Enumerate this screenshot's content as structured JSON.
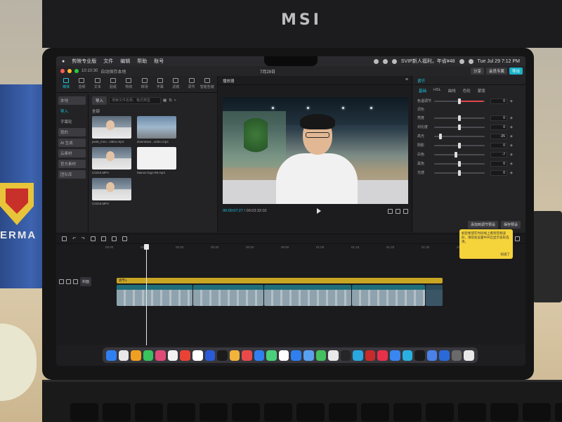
{
  "monitor": {
    "brand": "MSI"
  },
  "mug": {
    "text": "ERMA"
  },
  "keyboard": {
    "keys": [
      "",
      "",
      "",
      "",
      "",
      "",
      "",
      "",
      "",
      "",
      "",
      "",
      "",
      "",
      "",
      ""
    ]
  },
  "menubar": {
    "items": [
      "剪映专业版",
      "文件",
      "编辑",
      "帮助",
      "账号"
    ],
    "right_status": "SVIP新人福利，年省¥48",
    "clock": "Tue Jul 29  7:12 PM"
  },
  "titlebar": {
    "timer": "10:10:30",
    "autosave": "自动保存本地",
    "project_title": "7月29日",
    "buttons": [
      "分享",
      "会员专属",
      "导出"
    ]
  },
  "media": {
    "tools": [
      "媒体",
      "音频",
      "文本",
      "贴纸",
      "特效",
      "转场",
      "字幕",
      "滤镜",
      "调节",
      "智能包装"
    ],
    "categories": [
      "本地",
      "导入",
      "字幕轮",
      "我的",
      "AI 生成",
      "云素材",
      "官方素材",
      "团队库"
    ],
    "import_label": "导入",
    "search_placeholder": "搜索文件名称、格式类型",
    "all_label": "全部",
    "clips": [
      {
        "name": "peak_inno...video.mp4",
        "kind": "person"
      },
      {
        "name": "downtown...video.mp4",
        "kind": "city"
      },
      {
        "name": "C0316.MP4",
        "kind": "person"
      },
      {
        "name": "Manus-logo-99.mp4",
        "kind": "white"
      },
      {
        "name": "C0315.MP4",
        "kind": "person"
      }
    ]
  },
  "player": {
    "title": "播放器",
    "current_time": "00:00:07:27",
    "total_time": "00:03:32:02"
  },
  "adjust": {
    "title": "调节",
    "tabs": [
      "基础",
      "HSL",
      "曲线",
      "色轮",
      "蒙版"
    ],
    "top_row": {
      "label": "色温调节",
      "value": "0"
    },
    "section": "调色",
    "rows": [
      {
        "label": "亮度",
        "value": "0",
        "pos": 0.5
      },
      {
        "label": "对比度",
        "value": "0",
        "pos": 0.5
      },
      {
        "label": "高光",
        "value": "-35",
        "pos": 0.1
      },
      {
        "label": "阴影",
        "value": "0",
        "pos": 0.5
      },
      {
        "label": "白色",
        "value": "-7",
        "pos": 0.42
      },
      {
        "label": "黑色",
        "value": "0",
        "pos": 0.5
      },
      {
        "label": "光感",
        "value": "0",
        "pos": 0.5
      }
    ],
    "footer_buttons": [
      "添加到调节预设",
      "保存预设"
    ]
  },
  "tooltip": {
    "text": "如您希望在时间线上看到音频波形，请前往设置中开启显示波形选项。",
    "button": "知道了"
  },
  "timeline": {
    "ruler_marks": [
      "00:00",
      "00:10",
      "00:20",
      "00:30",
      "00:40",
      "00:50",
      "01:00",
      "01:10",
      "01:20",
      "01:30",
      "01:40",
      "01:50"
    ],
    "cover_label": "封面",
    "yellow_label": "调节1",
    "clips": [
      {
        "label": "C0316.MP4  00:00:29:07"
      },
      {
        "label": "C0315.MP4  00:00:20:03"
      },
      {
        "label": "C0316.MP4  00:00:29:15  清晰度 语速人声"
      },
      {
        "label": "C0316.MP4  00:00:21:03  清晰度 语速人声"
      },
      {
        "label": "Manus"
      }
    ]
  },
  "dock": {
    "colors": [
      "#2f7ff0",
      "#e8e8e8",
      "#f0a020",
      "#3ac25e",
      "#e04a78",
      "#f2f2f2",
      "#ea4335",
      "#ffffff",
      "#2a5ad8",
      "#1b1b1b",
      "#f2b33a",
      "#e84a4a",
      "#2f7ff0",
      "#4ad07a",
      "#ffffff",
      "#2f7ff0",
      "#5aa0f0",
      "#45c060",
      "#e9e9e9",
      "#262626",
      "#2aa8e0",
      "#c82a2a",
      "#e8304a",
      "#3a86f0",
      "#2ab0e0",
      "#1a1a1a",
      "#4a82e8",
      "#2a6ad8",
      "#6a6a6a",
      "#e8e8e8"
    ]
  }
}
